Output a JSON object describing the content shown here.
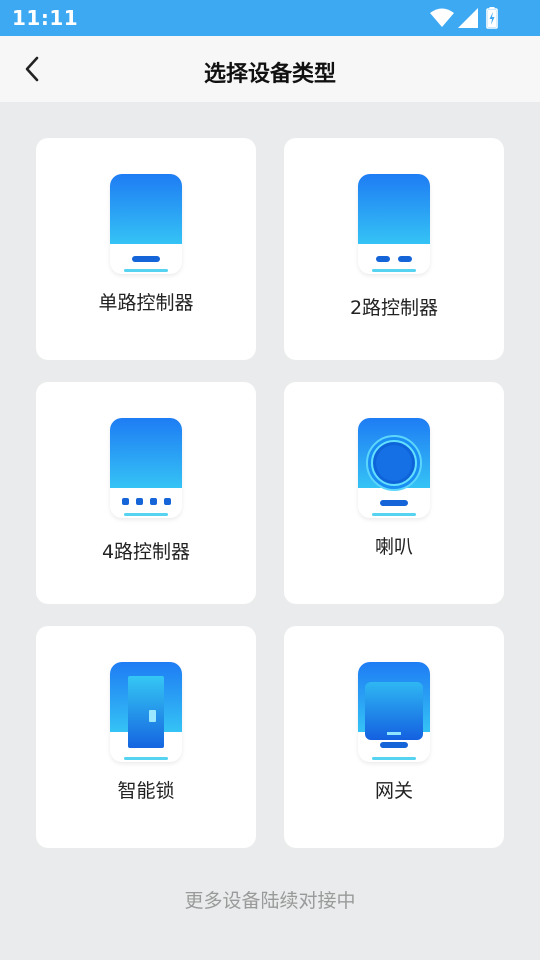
{
  "status_bar": {
    "time": "11:11"
  },
  "app_bar": {
    "title": "选择设备类型"
  },
  "devices": [
    {
      "label": "单路控制器"
    },
    {
      "label": "2路控制器"
    },
    {
      "label": "4路控制器"
    },
    {
      "label": "喇叭"
    },
    {
      "label": "智能锁"
    },
    {
      "label": "网关"
    }
  ],
  "footer": {
    "note": "更多设备陆续对接中"
  },
  "colors": {
    "status_bar": "#3da9f3",
    "accent": "#1565d8",
    "gradient_top": "#1e7cf4",
    "gradient_bottom": "#35c3f5"
  }
}
